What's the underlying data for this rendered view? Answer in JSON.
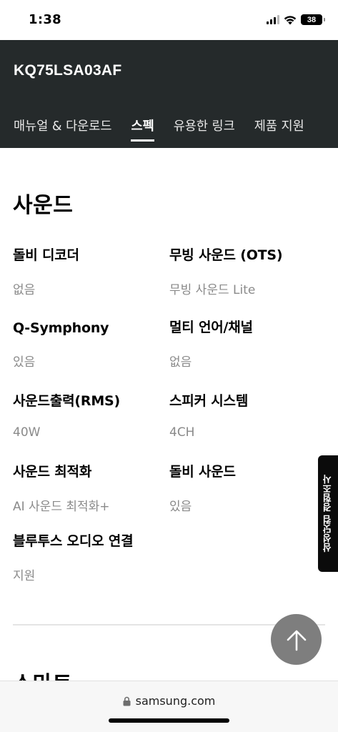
{
  "status_bar": {
    "time": "1:38",
    "battery": "38",
    "icons": [
      "signal-icon",
      "wifi-icon",
      "battery-icon"
    ]
  },
  "header": {
    "model": "KQ75LSA03AF",
    "tabs": [
      {
        "label": "매뉴얼 & 다운로드",
        "active": false
      },
      {
        "label": "스펙",
        "active": true
      },
      {
        "label": "유용한 링크",
        "active": false
      },
      {
        "label": "제품 지원",
        "active": false
      }
    ]
  },
  "section": {
    "title": "사운드",
    "specs": [
      {
        "label": "돌비 디코더",
        "value": "없음"
      },
      {
        "label": "무빙 사운드 (OTS)",
        "value": "무빙 사운드 Lite"
      },
      {
        "label": "Q-Symphony",
        "value": "있음"
      },
      {
        "label": "멀티 언어/채널",
        "value": "없음"
      },
      {
        "label": "사운드출력(RMS)",
        "value": "40W"
      },
      {
        "label": "스피커 시스템",
        "value": "4CH"
      },
      {
        "label": "사운드 최적화",
        "value": "AI 사운드 최적화+"
      },
      {
        "label": "돌비 사운드",
        "value": "있음"
      },
      {
        "label": "블루투스 오디오 연결",
        "value": "지원"
      }
    ]
  },
  "next_section": {
    "title": "스마트"
  },
  "survey_tab": {
    "label": "삼성닷컴 경험조사"
  },
  "scroll_top": {
    "icon": "arrow-up-icon"
  },
  "url_bar": {
    "url": "samsung.com",
    "icon": "lock-icon"
  },
  "colors": {
    "header_bg": "#252a2b",
    "value_gray": "#8a8a8a",
    "scroll_button": "#7e7e7e"
  }
}
